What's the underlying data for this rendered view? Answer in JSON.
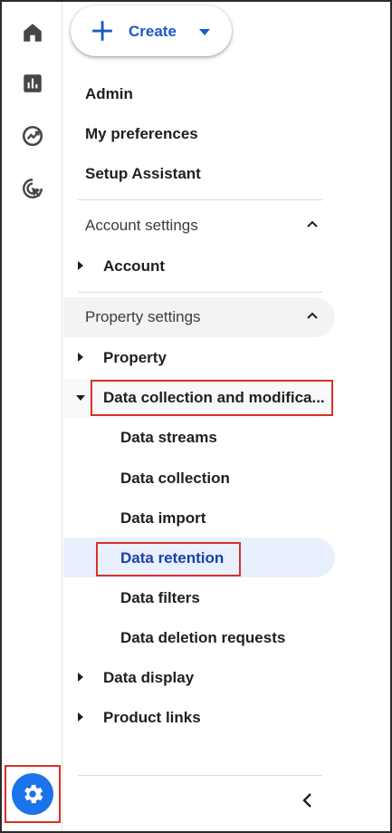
{
  "rail": {
    "items": [
      {
        "icon": "home-icon"
      },
      {
        "icon": "reports-icon"
      },
      {
        "icon": "explore-icon"
      },
      {
        "icon": "advertising-icon"
      }
    ],
    "settings_icon": "gear-icon"
  },
  "create": {
    "label": "Create"
  },
  "menu": {
    "admin": "Admin",
    "my_preferences": "My preferences",
    "setup_assistant": "Setup Assistant"
  },
  "account_settings": {
    "label": "Account settings",
    "items": [
      "Account"
    ]
  },
  "property_settings": {
    "label": "Property settings",
    "property": "Property",
    "data_collection": {
      "label": "Data collection and modifica...",
      "children": [
        "Data streams",
        "Data collection",
        "Data import",
        "Data retention",
        "Data filters",
        "Data deletion requests"
      ],
      "selected": "Data retention"
    },
    "data_display": "Data display",
    "product_links": "Product links"
  },
  "colors": {
    "accent": "#1a73e8",
    "selected_bg": "#e8f0fe",
    "selected_text": "#1a3fa8",
    "annotation_red": "#d93025"
  }
}
